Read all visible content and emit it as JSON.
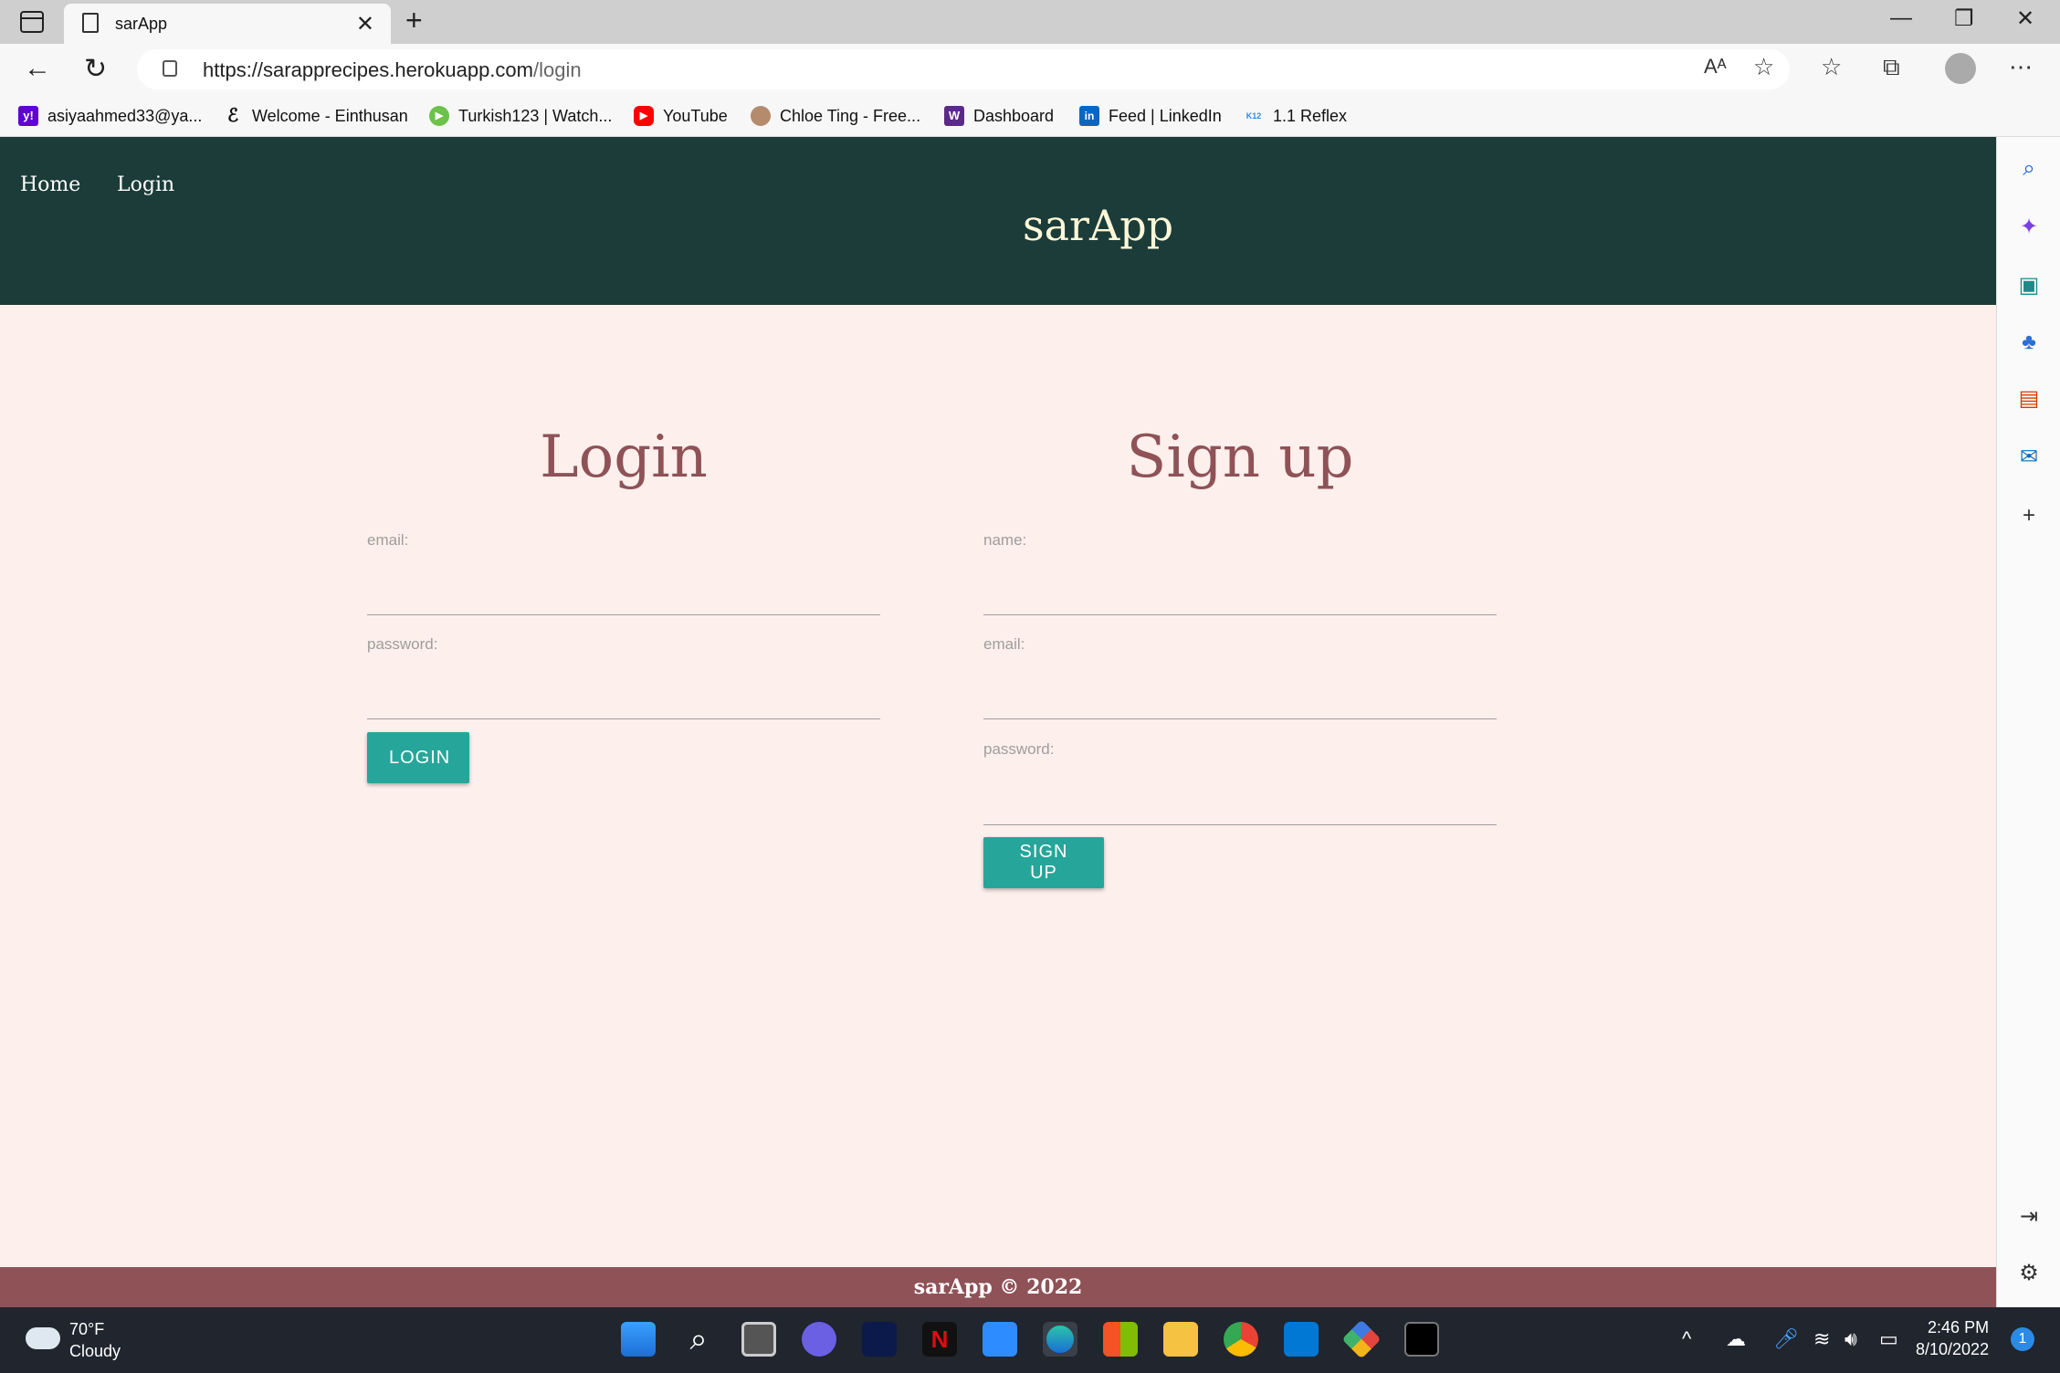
{
  "browser": {
    "tab_title": "sarApp",
    "url_host": "https://sarapprecipes.herokuapp.com",
    "url_path": "/login",
    "bookmarks": [
      {
        "label": "asiyaahmed33@ya...",
        "icon": "yahoo-icon"
      },
      {
        "label": "Welcome - Einthusan",
        "icon": "einthusan-icon"
      },
      {
        "label": "Turkish123 | Watch...",
        "icon": "play-icon"
      },
      {
        "label": "YouTube",
        "icon": "youtube-icon"
      },
      {
        "label": "Chloe Ting - Free...",
        "icon": "chloe-ting-icon"
      },
      {
        "label": "Dashboard",
        "icon": "w-icon"
      },
      {
        "label": "Feed | LinkedIn",
        "icon": "linkedin-icon"
      },
      {
        "label": "1.1 Reflex",
        "icon": "reflex-icon"
      }
    ]
  },
  "site": {
    "nav": {
      "home": "Home",
      "login": "Login"
    },
    "brand": "sarApp",
    "login_form": {
      "heading": "Login",
      "email_label": "email:",
      "password_label": "password:",
      "button": "LOGIN"
    },
    "signup_form": {
      "heading": "Sign up",
      "name_label": "name:",
      "email_label": "email:",
      "password_label": "password:",
      "button": "SIGN UP"
    },
    "footer": "sarApp © 2022"
  },
  "taskbar": {
    "temperature": "70°F",
    "condition": "Cloudy",
    "time": "2:46 PM",
    "date": "8/10/2022",
    "notification_count": "1"
  },
  "colors": {
    "header_bg": "#1b3c38",
    "page_bg": "#fdefec",
    "heading": "#8e5257",
    "button": "#26a69a",
    "footer_bg": "#8e5257"
  }
}
